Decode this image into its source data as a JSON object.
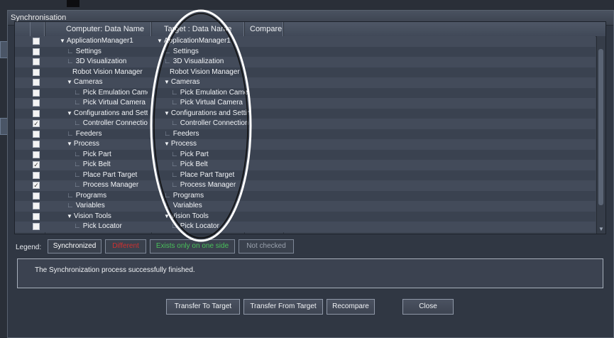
{
  "window": {
    "title": "Synchronisation"
  },
  "grid": {
    "columns": [
      "Computer: Data Name",
      "Target : Data Name",
      "Compare"
    ],
    "rows": [
      {
        "checked": false,
        "level": 0,
        "expand": true,
        "branch": "",
        "comp": "ApplicationManager1",
        "targ": "ApplicationManager1"
      },
      {
        "checked": false,
        "level": 1,
        "expand": false,
        "branch": "∟",
        "comp": "Settings",
        "targ": "Settings"
      },
      {
        "checked": false,
        "level": 1,
        "expand": false,
        "branch": "∟",
        "comp": "3D Visualization",
        "targ": "3D Visualization"
      },
      {
        "checked": false,
        "level": 1,
        "expand": false,
        "branch": "",
        "comp": "Robot Vision Manager",
        "targ": "Robot Vision Manager"
      },
      {
        "checked": false,
        "level": 1,
        "expand": true,
        "branch": "",
        "comp": "Cameras",
        "targ": "Cameras"
      },
      {
        "checked": false,
        "level": 2,
        "expand": false,
        "branch": "∟",
        "comp": "Pick Emulation Camera",
        "targ": "Pick Emulation Camera"
      },
      {
        "checked": false,
        "level": 2,
        "expand": false,
        "branch": "∟",
        "comp": "Pick Virtual Camera",
        "targ": "Pick Virtual Camera"
      },
      {
        "checked": false,
        "level": 1,
        "expand": true,
        "branch": "",
        "comp": "Configurations and Settings",
        "targ": "Configurations and Settings"
      },
      {
        "checked": true,
        "level": 2,
        "expand": false,
        "branch": "∟",
        "comp": "Controller Connection",
        "targ": "Controller Connection"
      },
      {
        "checked": false,
        "level": 1,
        "expand": false,
        "branch": "∟",
        "comp": "Feeders",
        "targ": "Feeders"
      },
      {
        "checked": false,
        "level": 1,
        "expand": true,
        "branch": "",
        "comp": "Process",
        "targ": "Process"
      },
      {
        "checked": false,
        "level": 2,
        "expand": false,
        "branch": "∟",
        "comp": "Pick Part",
        "targ": "Pick Part"
      },
      {
        "checked": true,
        "level": 2,
        "expand": false,
        "branch": "∟",
        "comp": "Pick Belt",
        "targ": "Pick Belt"
      },
      {
        "checked": false,
        "level": 2,
        "expand": false,
        "branch": "∟",
        "comp": "Place Part Target",
        "targ": "Place Part Target"
      },
      {
        "checked": true,
        "level": 2,
        "expand": false,
        "branch": "∟",
        "comp": "Process Manager",
        "targ": "Process Manager"
      },
      {
        "checked": false,
        "level": 1,
        "expand": false,
        "branch": "∟",
        "comp": "Programs",
        "targ": "Programs"
      },
      {
        "checked": false,
        "level": 1,
        "expand": false,
        "branch": "∟",
        "comp": "Variables",
        "targ": "Variables"
      },
      {
        "checked": false,
        "level": 1,
        "expand": true,
        "branch": "",
        "comp": "Vision Tools",
        "targ": "Vision Tools"
      },
      {
        "checked": false,
        "level": 2,
        "expand": false,
        "branch": "∟",
        "comp": "Pick Locator",
        "targ": "Pick Locator"
      }
    ]
  },
  "legend": {
    "label": "Legend:",
    "synchronized": "Synchronized",
    "different": "Different",
    "exists_one_side": "Exists only on one side",
    "not_checked": "Not checked",
    "colors": {
      "different": "#d03030",
      "exists_one_side": "#49c05a",
      "not_checked": "#9aa1ad"
    }
  },
  "status": {
    "message": "The Synchronization process successfully finished."
  },
  "buttons": {
    "transfer_to_target": "Transfer To Target",
    "transfer_from_target": "Transfer From Target",
    "recompare": "Recompare",
    "close": "Close"
  },
  "icons": {
    "expanded": "triangle-down-icon",
    "checked": "checkmark-icon"
  }
}
